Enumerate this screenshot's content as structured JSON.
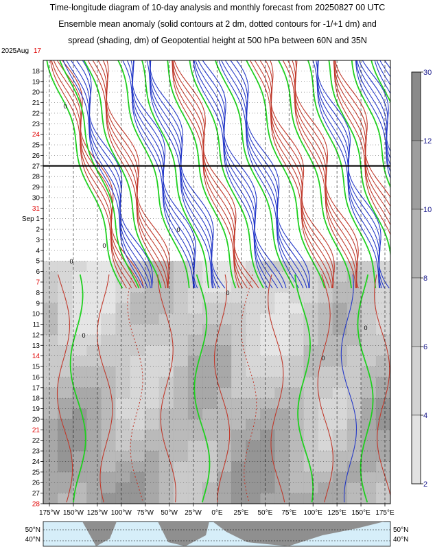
{
  "title_lines": [
    "Time-longitude diagram of 10-day analysis and monthly forecast from 20250827 00 UTC",
    "Ensemble mean anomaly (solid contours at 2 dm, dotted contours for -1/+1 dm) and",
    "spread (shading, dm) of Geopotential height at 500 hPa between 60N and 35N"
  ],
  "chart_data": {
    "type": "heatmap",
    "year_month_label": "2025Aug",
    "y_labels": [
      {
        "text": "17",
        "red": true
      },
      {
        "text": "18",
        "red": false
      },
      {
        "text": "19",
        "red": false
      },
      {
        "text": "20",
        "red": false
      },
      {
        "text": "21",
        "red": false
      },
      {
        "text": "22",
        "red": false
      },
      {
        "text": "23",
        "red": false
      },
      {
        "text": "24",
        "red": true
      },
      {
        "text": "25",
        "red": false
      },
      {
        "text": "26",
        "red": false
      },
      {
        "text": "27",
        "red": false
      },
      {
        "text": "28",
        "red": false
      },
      {
        "text": "29",
        "red": false
      },
      {
        "text": "30",
        "red": false
      },
      {
        "text": "31",
        "red": true
      },
      {
        "text": "Sep  1",
        "red": false
      },
      {
        "text": "2",
        "red": false
      },
      {
        "text": "3",
        "red": false
      },
      {
        "text": "4",
        "red": false
      },
      {
        "text": "5",
        "red": false
      },
      {
        "text": "6",
        "red": false
      },
      {
        "text": "7",
        "red": true
      },
      {
        "text": "8",
        "red": false
      },
      {
        "text": "9",
        "red": false
      },
      {
        "text": "10",
        "red": false
      },
      {
        "text": "11",
        "red": false
      },
      {
        "text": "12",
        "red": false
      },
      {
        "text": "13",
        "red": false
      },
      {
        "text": "14",
        "red": true
      },
      {
        "text": "15",
        "red": false
      },
      {
        "text": "16",
        "red": false
      },
      {
        "text": "17",
        "red": false
      },
      {
        "text": "18",
        "red": false
      },
      {
        "text": "19",
        "red": false
      },
      {
        "text": "20",
        "red": false
      },
      {
        "text": "21",
        "red": true
      },
      {
        "text": "22",
        "red": false
      },
      {
        "text": "23",
        "red": false
      },
      {
        "text": "24",
        "red": false
      },
      {
        "text": "25",
        "red": false
      },
      {
        "text": "26",
        "red": false
      },
      {
        "text": "27",
        "red": false
      },
      {
        "text": "28",
        "red": true
      }
    ],
    "x_labels": [
      "175°W",
      "150°W",
      "125°W",
      "100°W",
      "75°W",
      "50°W",
      "25°W",
      "0°E",
      "25°E",
      "50°E",
      "75°E",
      "100°E",
      "125°E",
      "150°E",
      "175°E"
    ],
    "analysis_forecast_divider_label": "27",
    "colorbar": {
      "labels": [
        "30",
        "12",
        "10",
        "8",
        "6",
        "4",
        "2"
      ],
      "shades": [
        "#8a8a8a",
        "#9e9e9e",
        "#b2b2b2",
        "#c4c4c4",
        "#d3d3d3",
        "#e2e2e2"
      ]
    },
    "contour_colors": {
      "positive": "#c0392b",
      "negative": "#2438c8",
      "zero": "#1fd11f"
    },
    "contour_zero_label": "0",
    "map": {
      "lat_labels": [
        "50°N",
        "40°N"
      ],
      "ocean": "#d6eef9",
      "land": "#8f8f8f"
    }
  }
}
